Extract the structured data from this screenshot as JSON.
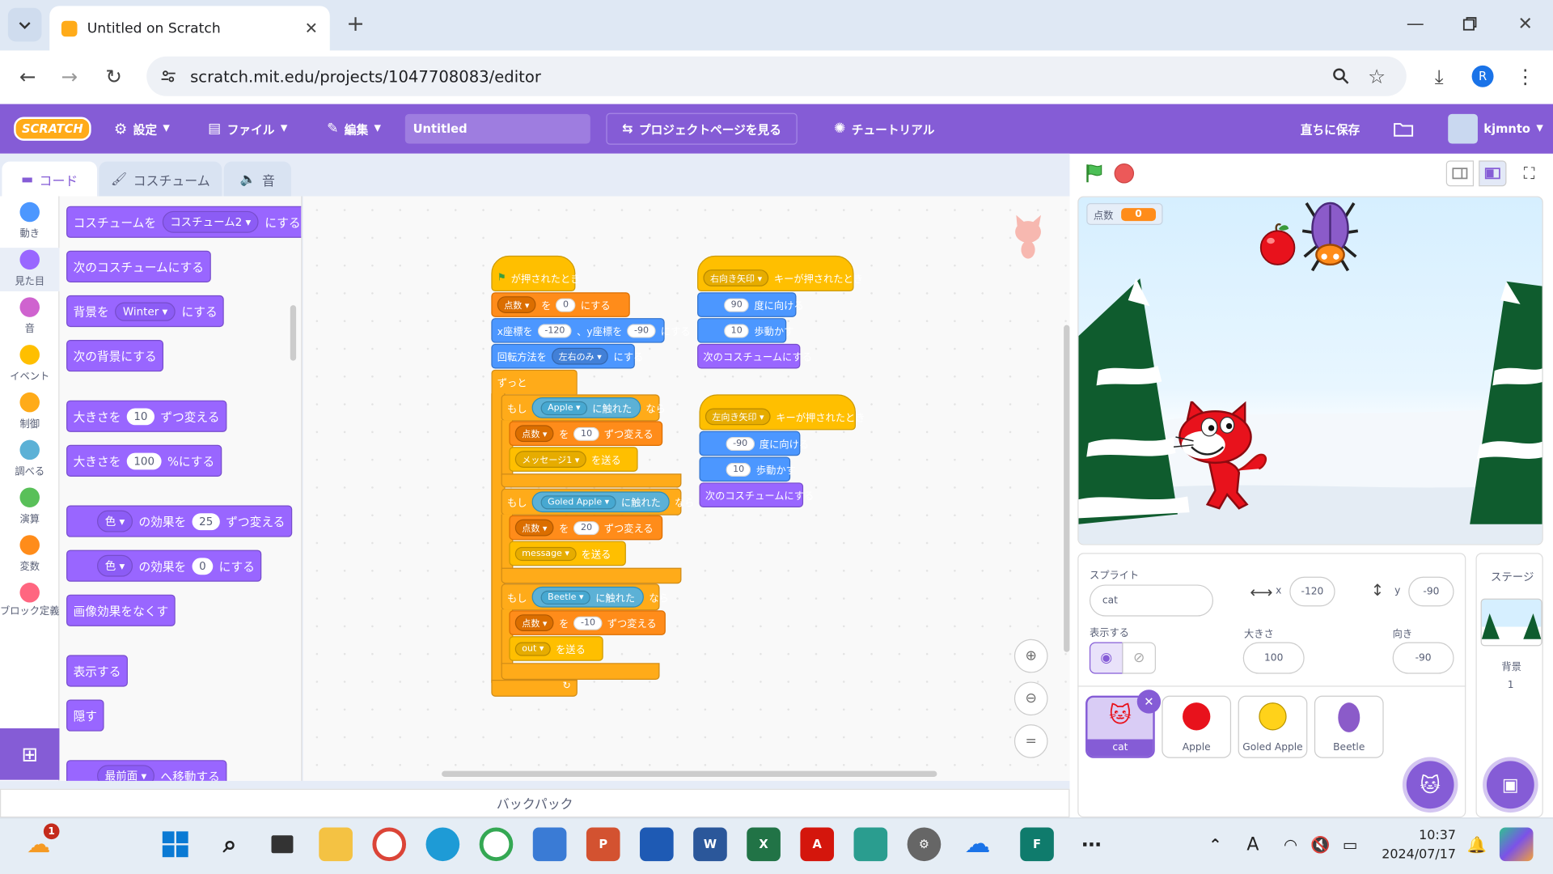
{
  "browser": {
    "tab_title": "Untitled on Scratch",
    "url": "scratch.mit.edu/projects/1047708083/editor",
    "profile_initial": "R"
  },
  "menubar": {
    "logo": "SCRATCH",
    "settings": "設定",
    "file": "ファイル",
    "edit": "編集",
    "project_title": "Untitled",
    "project_page": "プロジェクトページを見る",
    "tutorials": "チュートリアル",
    "save_now": "直ちに保存",
    "username": "kjmnto"
  },
  "editor_tabs": {
    "code": "コード",
    "costumes": "コスチューム",
    "sounds": "音"
  },
  "categories": [
    {
      "label": "動き",
      "color": "#4c97ff"
    },
    {
      "label": "見た目",
      "color": "#9966ff"
    },
    {
      "label": "音",
      "color": "#cf63cf"
    },
    {
      "label": "イベント",
      "color": "#ffbf00"
    },
    {
      "label": "制御",
      "color": "#ffab19"
    },
    {
      "label": "調べる",
      "color": "#5cb1d6"
    },
    {
      "label": "演算",
      "color": "#59c059"
    },
    {
      "label": "変数",
      "color": "#ff8c1a"
    },
    {
      "label": "ブロック定義",
      "color": "#ff6680"
    }
  ],
  "palette": {
    "switch_costume": {
      "pre": "コスチュームを",
      "value": "コスチューム2",
      "post": "にする"
    },
    "next_costume": "次のコスチュームにする",
    "switch_backdrop": {
      "pre": "背景を",
      "value": "Winter",
      "post": "にする"
    },
    "next_backdrop": "次の背景にする",
    "change_size": {
      "pre": "大きさを",
      "value": "10",
      "post": "ずつ変える"
    },
    "set_size": {
      "pre": "大きさを",
      "value": "100",
      "post": "%にする"
    },
    "change_effect": {
      "value": "色",
      "mid": "の効果を",
      "num": "25",
      "post": "ずつ変える"
    },
    "set_effect": {
      "value": "色",
      "mid": "の効果を",
      "num": "0",
      "post": "にする"
    },
    "clear_effects": "画像効果をなくす",
    "show": "表示する",
    "hide": "隠す",
    "go_front": {
      "value": "最前面",
      "post": "へ移動する"
    }
  },
  "script1": {
    "hat": "が押されたとき",
    "set_var": {
      "var": "点数",
      "to": "を",
      "val": "0",
      "post": "にする"
    },
    "goto": {
      "x_label": "x座標を",
      "x": "-120",
      "y_label": "、y座標を",
      "y": "-90",
      "post": "にする"
    },
    "rotation": {
      "pre": "回転方法を",
      "val": "左右のみ",
      "post": "にする"
    },
    "forever": "ずっと",
    "if_label": "もし",
    "then_label": "なら",
    "touching": "に触れた",
    "if1": {
      "obj": "Apple",
      "var": "点数",
      "by": "を",
      "val": "10",
      "post": "ずつ変える",
      "msg": "メッセージ1",
      "send": "を送る"
    },
    "if2": {
      "obj": "Goled Apple",
      "var": "点数",
      "by": "を",
      "val": "20",
      "post": "ずつ変える",
      "msg": "message",
      "send": "を送る"
    },
    "if3": {
      "obj": "Beetle",
      "var": "点数",
      "by": "を",
      "val": "-10",
      "post": "ずつ変える",
      "msg": "out",
      "send": "を送る"
    }
  },
  "script2": {
    "key": "右向き矢印",
    "hat": "キーが押されたとき",
    "point": {
      "val": "90",
      "post": "度に向ける"
    },
    "move": {
      "val": "10",
      "post": "歩動かす"
    },
    "next": "次のコスチュームにする"
  },
  "script3": {
    "key": "左向き矢印",
    "hat": "キーが押されたとき",
    "point": {
      "val": "-90",
      "post": "度に向ける"
    },
    "move": {
      "val": "10",
      "post": "歩動かす"
    },
    "next": "次のコスチュームにする"
  },
  "backpack": "バックパック",
  "stage": {
    "var_label": "点数",
    "var_value": "0"
  },
  "sprite_info": {
    "sprite_label": "スプライト",
    "name": "cat",
    "x_label": "x",
    "x": "-120",
    "y_label": "y",
    "y": "-90",
    "show_label": "表示する",
    "size_label": "大きさ",
    "size": "100",
    "dir_label": "向き",
    "direction": "-90"
  },
  "sprites": [
    {
      "name": "cat"
    },
    {
      "name": "Apple"
    },
    {
      "name": "Goled Apple"
    },
    {
      "name": "Beetle"
    }
  ],
  "stage_pane": {
    "title": "ステージ",
    "backdrop_label": "背景",
    "backdrop_count": "1"
  },
  "taskbar": {
    "time": "10:37",
    "date": "2024/07/17",
    "weather_badge": "1"
  }
}
